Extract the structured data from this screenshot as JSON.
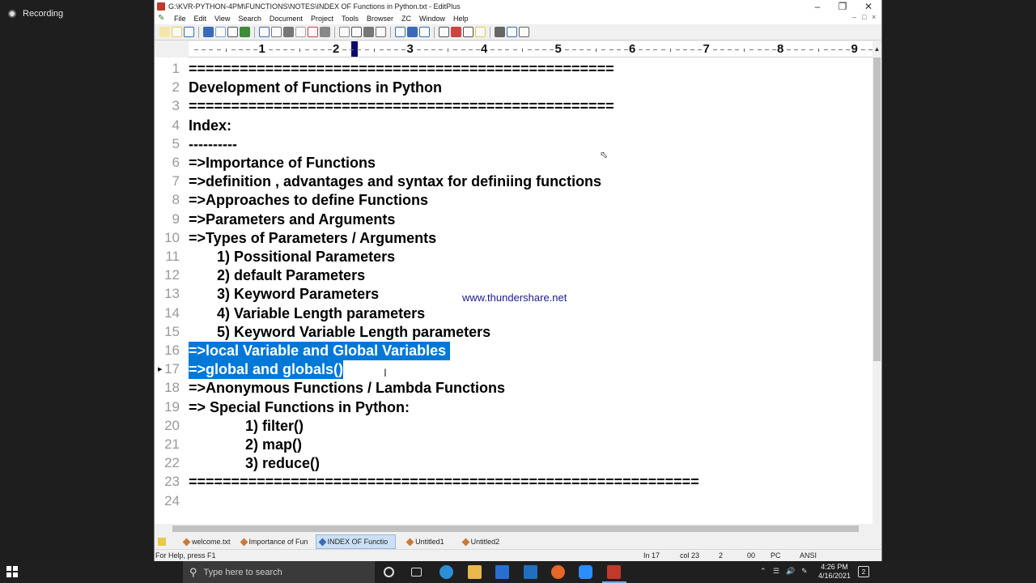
{
  "recording": {
    "label": "Recording"
  },
  "window": {
    "title": "G:\\KVR-PYTHON-4PM\\FUNCTIONS\\NOTES\\INDEX OF Functions in Python.txt - EditPlus",
    "min_icon": "minimize-icon",
    "max_icon": "restore-icon",
    "close_icon": "close-icon"
  },
  "menu": [
    "File",
    "Edit",
    "View",
    "Search",
    "Document",
    "Project",
    "Tools",
    "Browser",
    "ZC",
    "Window",
    "Help"
  ],
  "ruler": {
    "numbers": [
      "1",
      "2",
      "3",
      "4",
      "5",
      "6",
      "7",
      "8",
      "9"
    ]
  },
  "editor": {
    "lines": [
      {
        "n": "1",
        "text": "=================================================="
      },
      {
        "n": "2",
        "text": "Development of Functions in Python"
      },
      {
        "n": "3",
        "text": "=================================================="
      },
      {
        "n": "4",
        "text": "Index:"
      },
      {
        "n": "5",
        "text": "----------"
      },
      {
        "n": "6",
        "text": "=>Importance of Functions"
      },
      {
        "n": "7",
        "text": "=>definition , advantages and syntax for definiing functions"
      },
      {
        "n": "8",
        "text": "=>Approaches to define Functions"
      },
      {
        "n": "9",
        "text": "=>Parameters and Arguments"
      },
      {
        "n": "10",
        "text": "=>Types of Parameters / Arguments"
      },
      {
        "n": "11",
        "text": "       1) Possitional Parameters"
      },
      {
        "n": "12",
        "text": "       2) default Parameters"
      },
      {
        "n": "13",
        "text": "       3) Keyword Parameters"
      },
      {
        "n": "14",
        "text": "       4) Variable Length parameters"
      },
      {
        "n": "15",
        "text": "       5) Keyword Variable Length parameters"
      },
      {
        "n": "16",
        "text": "=>local Variable and Global Variables "
      },
      {
        "n": "17",
        "text": "=>global and globals()"
      },
      {
        "n": "18",
        "text": "=>Anonymous Functions / Lambda Functions"
      },
      {
        "n": "19",
        "text": "=> Special Functions in Python:"
      },
      {
        "n": "20",
        "text": "              1) filter()"
      },
      {
        "n": "21",
        "text": "              2) map()"
      },
      {
        "n": "22",
        "text": "              3) reduce()"
      },
      {
        "n": "23",
        "text": "============================================================"
      },
      {
        "n": "24",
        "text": ""
      }
    ],
    "watermark": "www.thundershare.net",
    "selected_lines": [
      "16",
      "17"
    ]
  },
  "tabs": [
    {
      "label": "welcome.txt",
      "active": false
    },
    {
      "label": "Importance of Fun",
      "active": false
    },
    {
      "label": "INDEX OF Functio",
      "active": true
    },
    {
      "label": "Untitled1",
      "active": false
    },
    {
      "label": "Untitled2",
      "active": false
    }
  ],
  "status": {
    "help": "For Help, press F1",
    "line": "In 17",
    "col": "col 23",
    "field3": "2",
    "field4": "00",
    "mode": "PC",
    "encoding": "ANSI"
  },
  "taskbar": {
    "search_placeholder": "Type here to search",
    "time": "4:26 PM",
    "date": "4/16/2021",
    "icons": [
      "windows-start-icon",
      "cortana-icon",
      "task-view-icon",
      "edge-icon",
      "file-explorer-icon",
      "store-icon",
      "mail-icon",
      "firefox-icon",
      "zoom-icon",
      "editplus-icon"
    ]
  }
}
